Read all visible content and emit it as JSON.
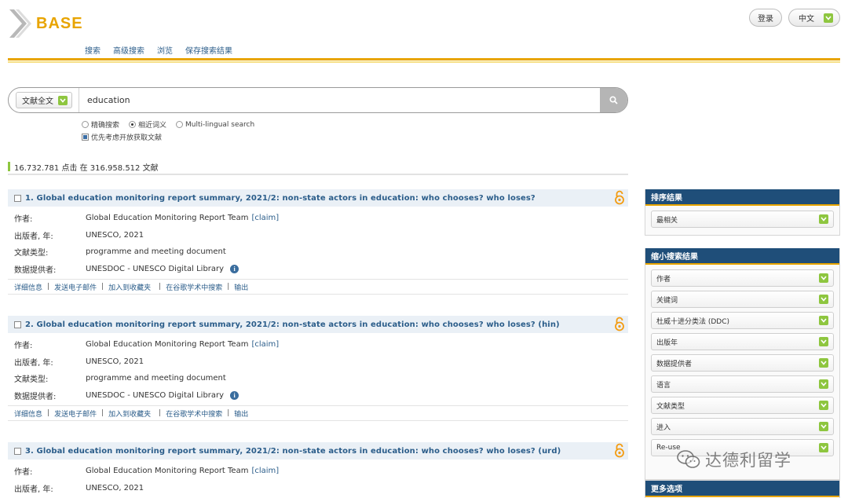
{
  "header": {
    "logo_text": "BASE",
    "nav": [
      "搜索",
      "高级搜索",
      "浏览",
      "保存搜索结果"
    ],
    "login": "登录",
    "language": "中文"
  },
  "search": {
    "type_label": "文献全文",
    "query": "education",
    "options": {
      "exact": "精确搜索",
      "synonyms": "相近词义",
      "multilingual": "Multi-lingual search",
      "open_access": "优先考虑开放获取文献"
    }
  },
  "hit_count": "16.732.781 点击 在 316.958.512 文献",
  "field_labels": {
    "author": "作者:",
    "publisher": "出版者, 年:",
    "doc_type": "文献类型:",
    "provider": "数据提供者:"
  },
  "actions": [
    "详细信息",
    "发送电子邮件",
    "加入到收藏夹",
    "在谷歌学术中搜索",
    "输出"
  ],
  "results": [
    {
      "title": "1. Global education monitoring report summary, 2021/2: non-state actors in education: who chooses? who loses?",
      "author": "Global Education Monitoring Report Team",
      "claim": "[claim]",
      "publisher": "UNESCO, 2021",
      "doc_type": "programme and meeting document",
      "provider": "UNESDOC - UNESCO Digital Library"
    },
    {
      "title": "2. Global education monitoring report summary, 2021/2: non-state actors in education: who chooses? who loses? (hin)",
      "author": "Global Education Monitoring Report Team",
      "claim": "[claim]",
      "publisher": "UNESCO, 2021",
      "doc_type": "programme and meeting document",
      "provider": "UNESDOC - UNESCO Digital Library"
    },
    {
      "title": "3. Global education monitoring report summary, 2021/2: non-state actors in education: who chooses? who loses? (urd)",
      "author": "Global Education Monitoring Report Team",
      "claim": "[claim]",
      "publisher": "UNESCO, 2021"
    }
  ],
  "sidebar": {
    "sort_title": "排序结果",
    "sort_value": "最相关",
    "refine_title": "缩小搜索结果",
    "refine_items": [
      "作者",
      "关键词",
      "杜威十进分类法 (DDC)",
      "出版年",
      "数据提供者",
      "语言",
      "文献类型",
      "进入",
      "Re-use"
    ],
    "more_title": "更多选项"
  },
  "watermark": "达德利留学",
  "colors": {
    "brand": "#e8a400",
    "link": "#2b5d8a",
    "sidebar_header": "#1f4e79",
    "dropdown_green": "#8ec63f",
    "open_access_orange": "#f39c12"
  }
}
